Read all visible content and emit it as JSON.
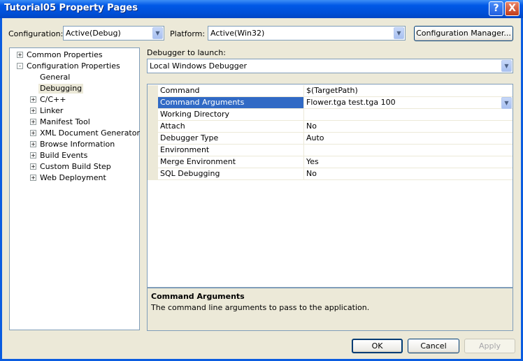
{
  "window": {
    "title": "Tutorial05 Property Pages",
    "help_glyph": "?",
    "close_glyph": "X"
  },
  "toolbar": {
    "configuration_label": "Configuration:",
    "configuration_value": "Active(Debug)",
    "platform_label": "Platform:",
    "platform_value": "Active(Win32)",
    "config_manager_label": "Configuration Manager..."
  },
  "tree": {
    "items": [
      {
        "label": "Common Properties",
        "expander": "+"
      },
      {
        "label": "Configuration Properties",
        "expander": "-"
      },
      {
        "label": "General"
      },
      {
        "label": "Debugging",
        "selected": true
      },
      {
        "label": "C/C++",
        "expander": "+"
      },
      {
        "label": "Linker",
        "expander": "+"
      },
      {
        "label": "Manifest Tool",
        "expander": "+"
      },
      {
        "label": "XML Document Generator",
        "expander": "+"
      },
      {
        "label": "Browse Information",
        "expander": "+"
      },
      {
        "label": "Build Events",
        "expander": "+"
      },
      {
        "label": "Custom Build Step",
        "expander": "+"
      },
      {
        "label": "Web Deployment",
        "expander": "+"
      }
    ]
  },
  "debugger": {
    "label": "Debugger to launch:",
    "value": "Local Windows Debugger"
  },
  "properties": [
    {
      "name": "Command",
      "value": "$(TargetPath)"
    },
    {
      "name": "Command Arguments",
      "value": "Flower.tga test.tga 100",
      "selected": true
    },
    {
      "name": "Working Directory",
      "value": ""
    },
    {
      "name": "Attach",
      "value": "No"
    },
    {
      "name": "Debugger Type",
      "value": "Auto"
    },
    {
      "name": "Environment",
      "value": ""
    },
    {
      "name": "Merge Environment",
      "value": "Yes"
    },
    {
      "name": "SQL Debugging",
      "value": "No"
    }
  ],
  "description": {
    "title": "Command Arguments",
    "text": "The command line arguments to pass to the application."
  },
  "buttons": {
    "ok": "OK",
    "cancel": "Cancel",
    "apply": "Apply"
  },
  "dropdown_glyph": "▼",
  "colors": {
    "selection": "#316ac5",
    "titlebar": "#0058e6",
    "face": "#ece9d8"
  }
}
